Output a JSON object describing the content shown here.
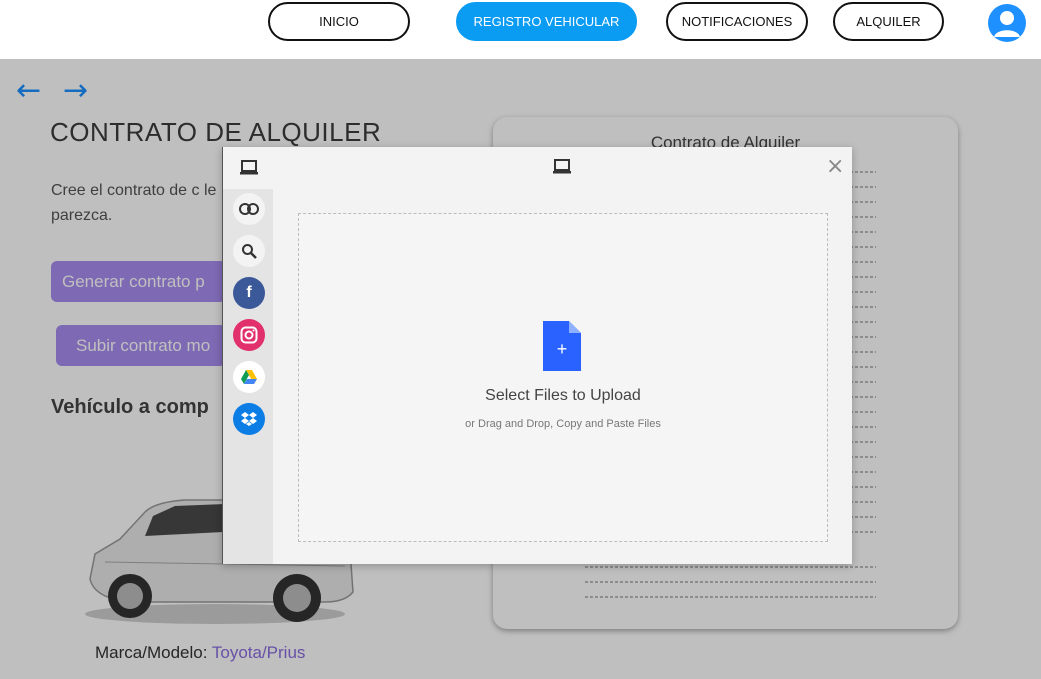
{
  "navbar": {
    "items": [
      {
        "label": "INICIO",
        "active": false
      },
      {
        "label": "REGISTRO VEHICULAR",
        "active": true
      },
      {
        "label": "NOTIFICACIONES",
        "active": false
      },
      {
        "label": "ALQUILER",
        "active": false
      }
    ],
    "avatar_icon": "user-avatar-icon"
  },
  "page": {
    "back_icon": "arrow-left-icon",
    "forward_icon": "arrow-right-icon",
    "back_glyph": "←",
    "forward_glyph": "→",
    "title": "CONTRATO DE ALQUILER",
    "description": "Cree el contrato de c le parezca.",
    "generate_button": "Generar contrato p",
    "upload_button": "Subir contrato mo",
    "vehicle_heading": "Vehículo a comp",
    "brand_label": "Marca/Modelo: ",
    "brand_value": "Toyota/Prius"
  },
  "contract": {
    "title": "Contrato de Alquiler"
  },
  "upload_dialog": {
    "header_icon": "computer-icon",
    "close_glyph": "×",
    "sources": [
      "computer-icon",
      "link-icon",
      "search-icon",
      "facebook-icon",
      "instagram-icon",
      "google-drive-icon",
      "dropbox-icon"
    ],
    "file_glyph": "+",
    "select_title": "Select Files to Upload",
    "select_subtitle": "or Drag and Drop, Copy and Paste Files"
  },
  "colors": {
    "accent": "#0a9bf2",
    "purple": "#a98df0",
    "brand_value": "#8a6ce0",
    "file_icon": "#2962ff"
  }
}
